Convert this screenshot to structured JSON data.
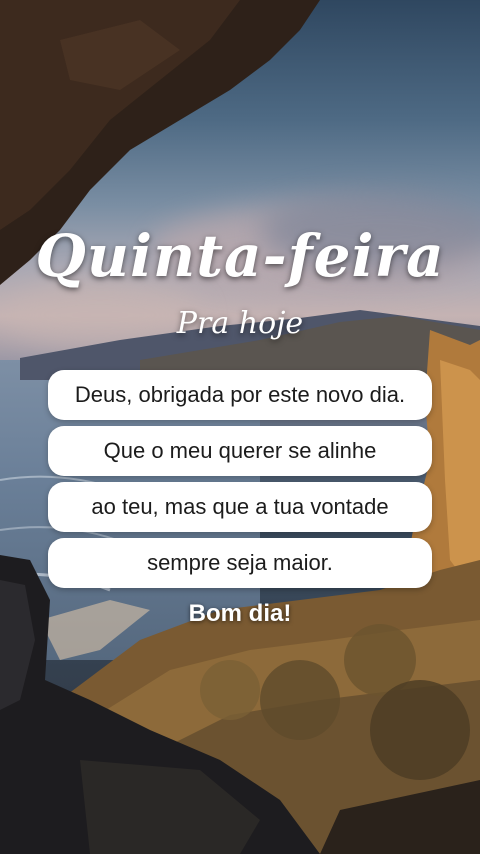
{
  "image": {
    "title": "Quinta-feira",
    "subtitle": "Pra hoje",
    "message_lines": [
      "Deus, obrigada por este novo dia.",
      "Que o meu querer se alinhe",
      "ao teu, mas que a tua vontade",
      "sempre seja maior."
    ],
    "greeting": "Bom dia!"
  },
  "colors": {
    "pill_background": "#ffffff",
    "text_dark": "#1c1c1c",
    "title_white": "#ffffff"
  }
}
